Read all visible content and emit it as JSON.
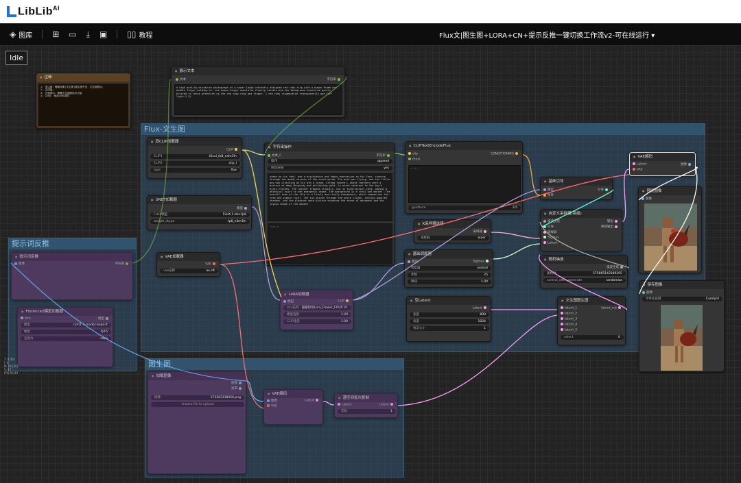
{
  "brand": {
    "name": "LibLib",
    "sup": "AI"
  },
  "toolbar": {
    "gallery": "图库",
    "tutorial": "教程",
    "workflow_title": "Flux文|图生图+LORA+CN+提示反推一键切换工作流v2-可在线运行 ▾"
  },
  "status": "Idle",
  "groups": {
    "flux": "Flux-文生图",
    "prompt": "提示词反推",
    "img2img": "图生图"
  },
  "nodes": {
    "note": {
      "title": "注释",
      "text": "1: 关注度：需要设置|文生图|图生图开关，文生图默认；\n2: 生成值；\n3: 正面提示：需要在生成图选中分级\n4: LORA: 使用LORA插件"
    },
    "show_text": {
      "title": "展示文本",
      "in": "文本",
      "out": "字符串",
      "text": "A high quality miniature photograph of a super-large vibrantly designed red ruby ring with a human thumb and middle finger holding it, the human finger should be clearly visible and the background should be gently blurred to focus attention on the red ruby ring and finger, I red ruby ringmarbles transparently and Soft light:1.3)"
    },
    "dual_clip": {
      "title": "双CLIP加载器",
      "out": "CLIP",
      "w1_l": "CLIP1",
      "w1_v": "t5xxl_fp8_e4m3fn",
      "w2_l": "CLIP2",
      "w2_v": "clip_l",
      "w3_l": "type",
      "w3_v": "flux"
    },
    "unet": {
      "title": "UNET加载器",
      "out": "模型",
      "w1_l": "FLUX模型",
      "w1_v": "FLUX.1-dev-fp8",
      "w2_l": "weight_dtype",
      "w2_v": "fp8_e4m3fn"
    },
    "vae": {
      "title": "VAE加载器",
      "out": "VAE",
      "w1_l": "vae名称",
      "w1_v": "ae.sft"
    },
    "strop": {
      "title": "字符串操作",
      "in": "文本_C",
      "out": "字符串",
      "w1_l": "操作",
      "w1_v": "append",
      "w2_l": "附加分隔",
      "w2_v": "yes",
      "text": "stems on his feet, and a mischievous and happy expression on his face, running through the muddy streets of the countryside. The dust was flying, and the little boy was clutching on his arm a large, strong rooster, whose feathers were a mixture of deep Burgundy and glittering gold, in stark contrast to the boy's plain clothes. The rooster frowned slightly, but is surprisingly calm, adding a whimsical twist to the energetic chase. The background is a rural wet market. The overall tone of the film is a lively and lively atmosphere, which summarizes the free and simple rural. The sun shines through the white clouds, casting dappled shadows, and the pleasant warm picture enhances the sense of movement and the joyous shade of the moment.",
      "text2": "text_b"
    },
    "clipenc": {
      "title": "CLIPTextEncodeFlux",
      "in1": "clip",
      "in2": "t5xxl",
      "out": "CONDITIONING",
      "w_l": "guidance",
      "w_v": "3.5",
      "ph": "clip_l"
    },
    "basic_guide": {
      "title": "基础引导",
      "in1": "模型",
      "in2": "条件",
      "out": "引导"
    },
    "sampler_sel": {
      "title": "K采样器选择",
      "out": "采样器",
      "w_l": "采样器",
      "w_v": "euler"
    },
    "custom_sampler": {
      "title": "自定义采样器(高级)",
      "in": [
        "噪波生成",
        "引导",
        "采样器",
        "Sigmas",
        "Latent"
      ],
      "out1": "输出",
      "out2": "降噪输出"
    },
    "scheduler": {
      "title": "基础调度器",
      "in": "模型",
      "out": "Sigmas",
      "w1_l": "调度器",
      "w1_v": "normal",
      "w2_l": "步数",
      "w2_v": "25",
      "w3_l": "降噪",
      "w3_v": "1.00"
    },
    "noise": {
      "title": "随机噪波",
      "out": "噪波生成",
      "w1_l": "随机种",
      "w1_v": "575865143189205",
      "w2_l": "control_after_generate",
      "w2_v": "randomize"
    },
    "empty_latent": {
      "title": "空Latent",
      "out": "Latent",
      "w1_l": "宽度",
      "w1_v": "800",
      "w2_l": "高度",
      "w2_v": "1024",
      "w3_l": "批次大小",
      "w3_v": "1"
    },
    "latent_switch": {
      "title": "文生图图生图",
      "in": [
        "latent_1",
        "latent_2",
        "latent_3",
        "latent_4",
        "latent_5"
      ],
      "out": "latent_out",
      "w_l": "select",
      "w_v": "0"
    },
    "vae_decode": {
      "title": "VAE解码",
      "in1": "Latent",
      "in2": "VAE",
      "out": "图像"
    },
    "preview": {
      "title": "预览图像",
      "in": "图像"
    },
    "save": {
      "title": "保存图像",
      "in": "图像",
      "w_l": "文件名前缀",
      "w_v": "ComfyUI"
    },
    "lora": {
      "title": "LoRA加载器",
      "in1": "模型",
      "in2": "CLIP",
      "out1": "模型",
      "out2": "CLIP",
      "w1_l": "lora名称",
      "w1_v": "超级好玩Lora_Flower_FOUR V1",
      "w2_l": "模型强度",
      "w2_v": "1.00",
      "w3_l": "CLIP强度",
      "w3_v": "1.00"
    },
    "florence": {
      "title": "提示词反推",
      "in": "图像",
      "out": "字符串"
    },
    "florence_load": {
      "title": "Florence2模型加载器",
      "in": "lora",
      "out": "模型",
      "w1_l": "模型",
      "w1_v": "ruf-t1.5-model-large-ft",
      "w2_l": "精度",
      "w2_v": "fp16",
      "w3_l": "注意力",
      "w3_v": "sdpa"
    },
    "load_img": {
      "title": "加载图像",
      "out1": "图像",
      "out2": "遮罩",
      "w_l": "图像",
      "w_v": "173363138026.png",
      "btn": "choose file to upload"
    },
    "vae_encode": {
      "title": "VAE编码",
      "in1": "图像",
      "in2": "VAE",
      "out": "Latent"
    },
    "latent_batch": {
      "title": "潜空间批次复制",
      "in": "Latent",
      "out": "Latent",
      "w_l": "次数",
      "w_v": "1"
    }
  },
  "stats": "T: 0.00s\nI: 0\nN: 26 [26]\nV: 47\nFPS:59.49"
}
